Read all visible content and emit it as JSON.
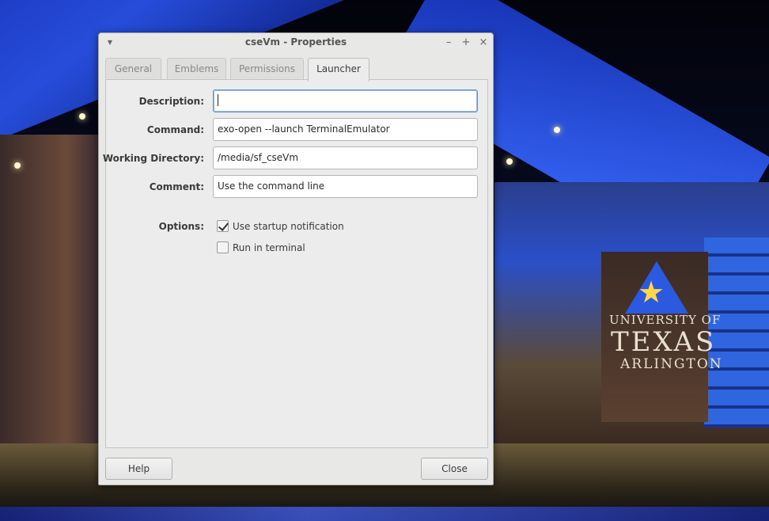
{
  "window": {
    "title": "cseVm - Properties",
    "menu_icon": "menu-arrow-icon",
    "controls": {
      "minimize": "–",
      "maximize": "+",
      "close": "×"
    }
  },
  "tabs": [
    {
      "label": "General",
      "active": false
    },
    {
      "label": "Emblems",
      "active": false
    },
    {
      "label": "Permissions",
      "active": false
    },
    {
      "label": "Launcher",
      "active": true
    }
  ],
  "launcher": {
    "description": {
      "label": "Description:",
      "value": ""
    },
    "command": {
      "label": "Command:",
      "value": "exo-open --launch TerminalEmulator"
    },
    "working_directory": {
      "label": "Working Directory:",
      "value": "/media/sf_cseVm"
    },
    "comment": {
      "label": "Comment:",
      "value": "Use the command line"
    },
    "options_label": "Options:",
    "options": [
      {
        "label": "Use startup notification",
        "checked": true
      },
      {
        "label": "Run in terminal",
        "checked": false
      }
    ]
  },
  "buttons": {
    "help": "Help",
    "close": "Close"
  },
  "wallpaper": {
    "line1": "UNIVERSITY OF",
    "line2": "TEXAS",
    "line3": "ARLINGTON"
  },
  "colors": {
    "focus_border": "#5b8fd6",
    "window_bg": "#e8e8e7"
  }
}
